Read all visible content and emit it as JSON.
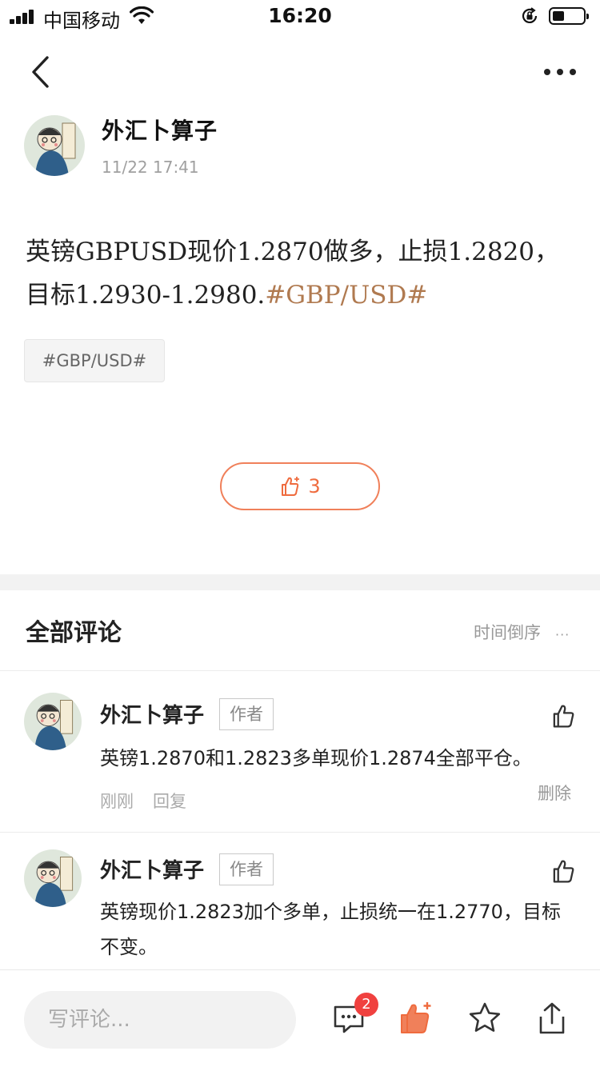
{
  "status_bar": {
    "carrier": "中国移动",
    "time": "16:20"
  },
  "post": {
    "author": "外汇卜算子",
    "time": "11/22 17:41",
    "text_main": "英镑GBPUSD现价1.2870做多，止损1.2820，目标1.2930-1.2980.",
    "text_hashtag": "#GBP/USD#",
    "tag": "#GBP/USD#",
    "like_count": "3"
  },
  "comments_section": {
    "title": "全部评论",
    "sort_label": "时间倒序",
    "sort_more": "···"
  },
  "comments": [
    {
      "author": "外汇卜算子",
      "badge": "作者",
      "text": "英镑1.2870和1.2823多单现价1.2874全部平仓。",
      "time": "刚刚",
      "reply": "回复",
      "delete": "删除"
    },
    {
      "author": "外汇卜算子",
      "badge": "作者",
      "text": "英镑现价1.2823加个多单，止损统一在1.2770，目标不变。"
    }
  ],
  "bottom_bar": {
    "input_placeholder": "写评论...",
    "comment_badge": "2"
  },
  "colors": {
    "accent": "#ef6b3e",
    "hashtag": "#b07a50",
    "badge_red": "#f0413f"
  },
  "icons": [
    "signal-icon",
    "wifi-icon",
    "rotation-lock-icon",
    "battery-icon",
    "back-arrow-icon",
    "more-icon",
    "thumbs-up-icon",
    "comment-icon",
    "star-icon",
    "share-icon"
  ]
}
